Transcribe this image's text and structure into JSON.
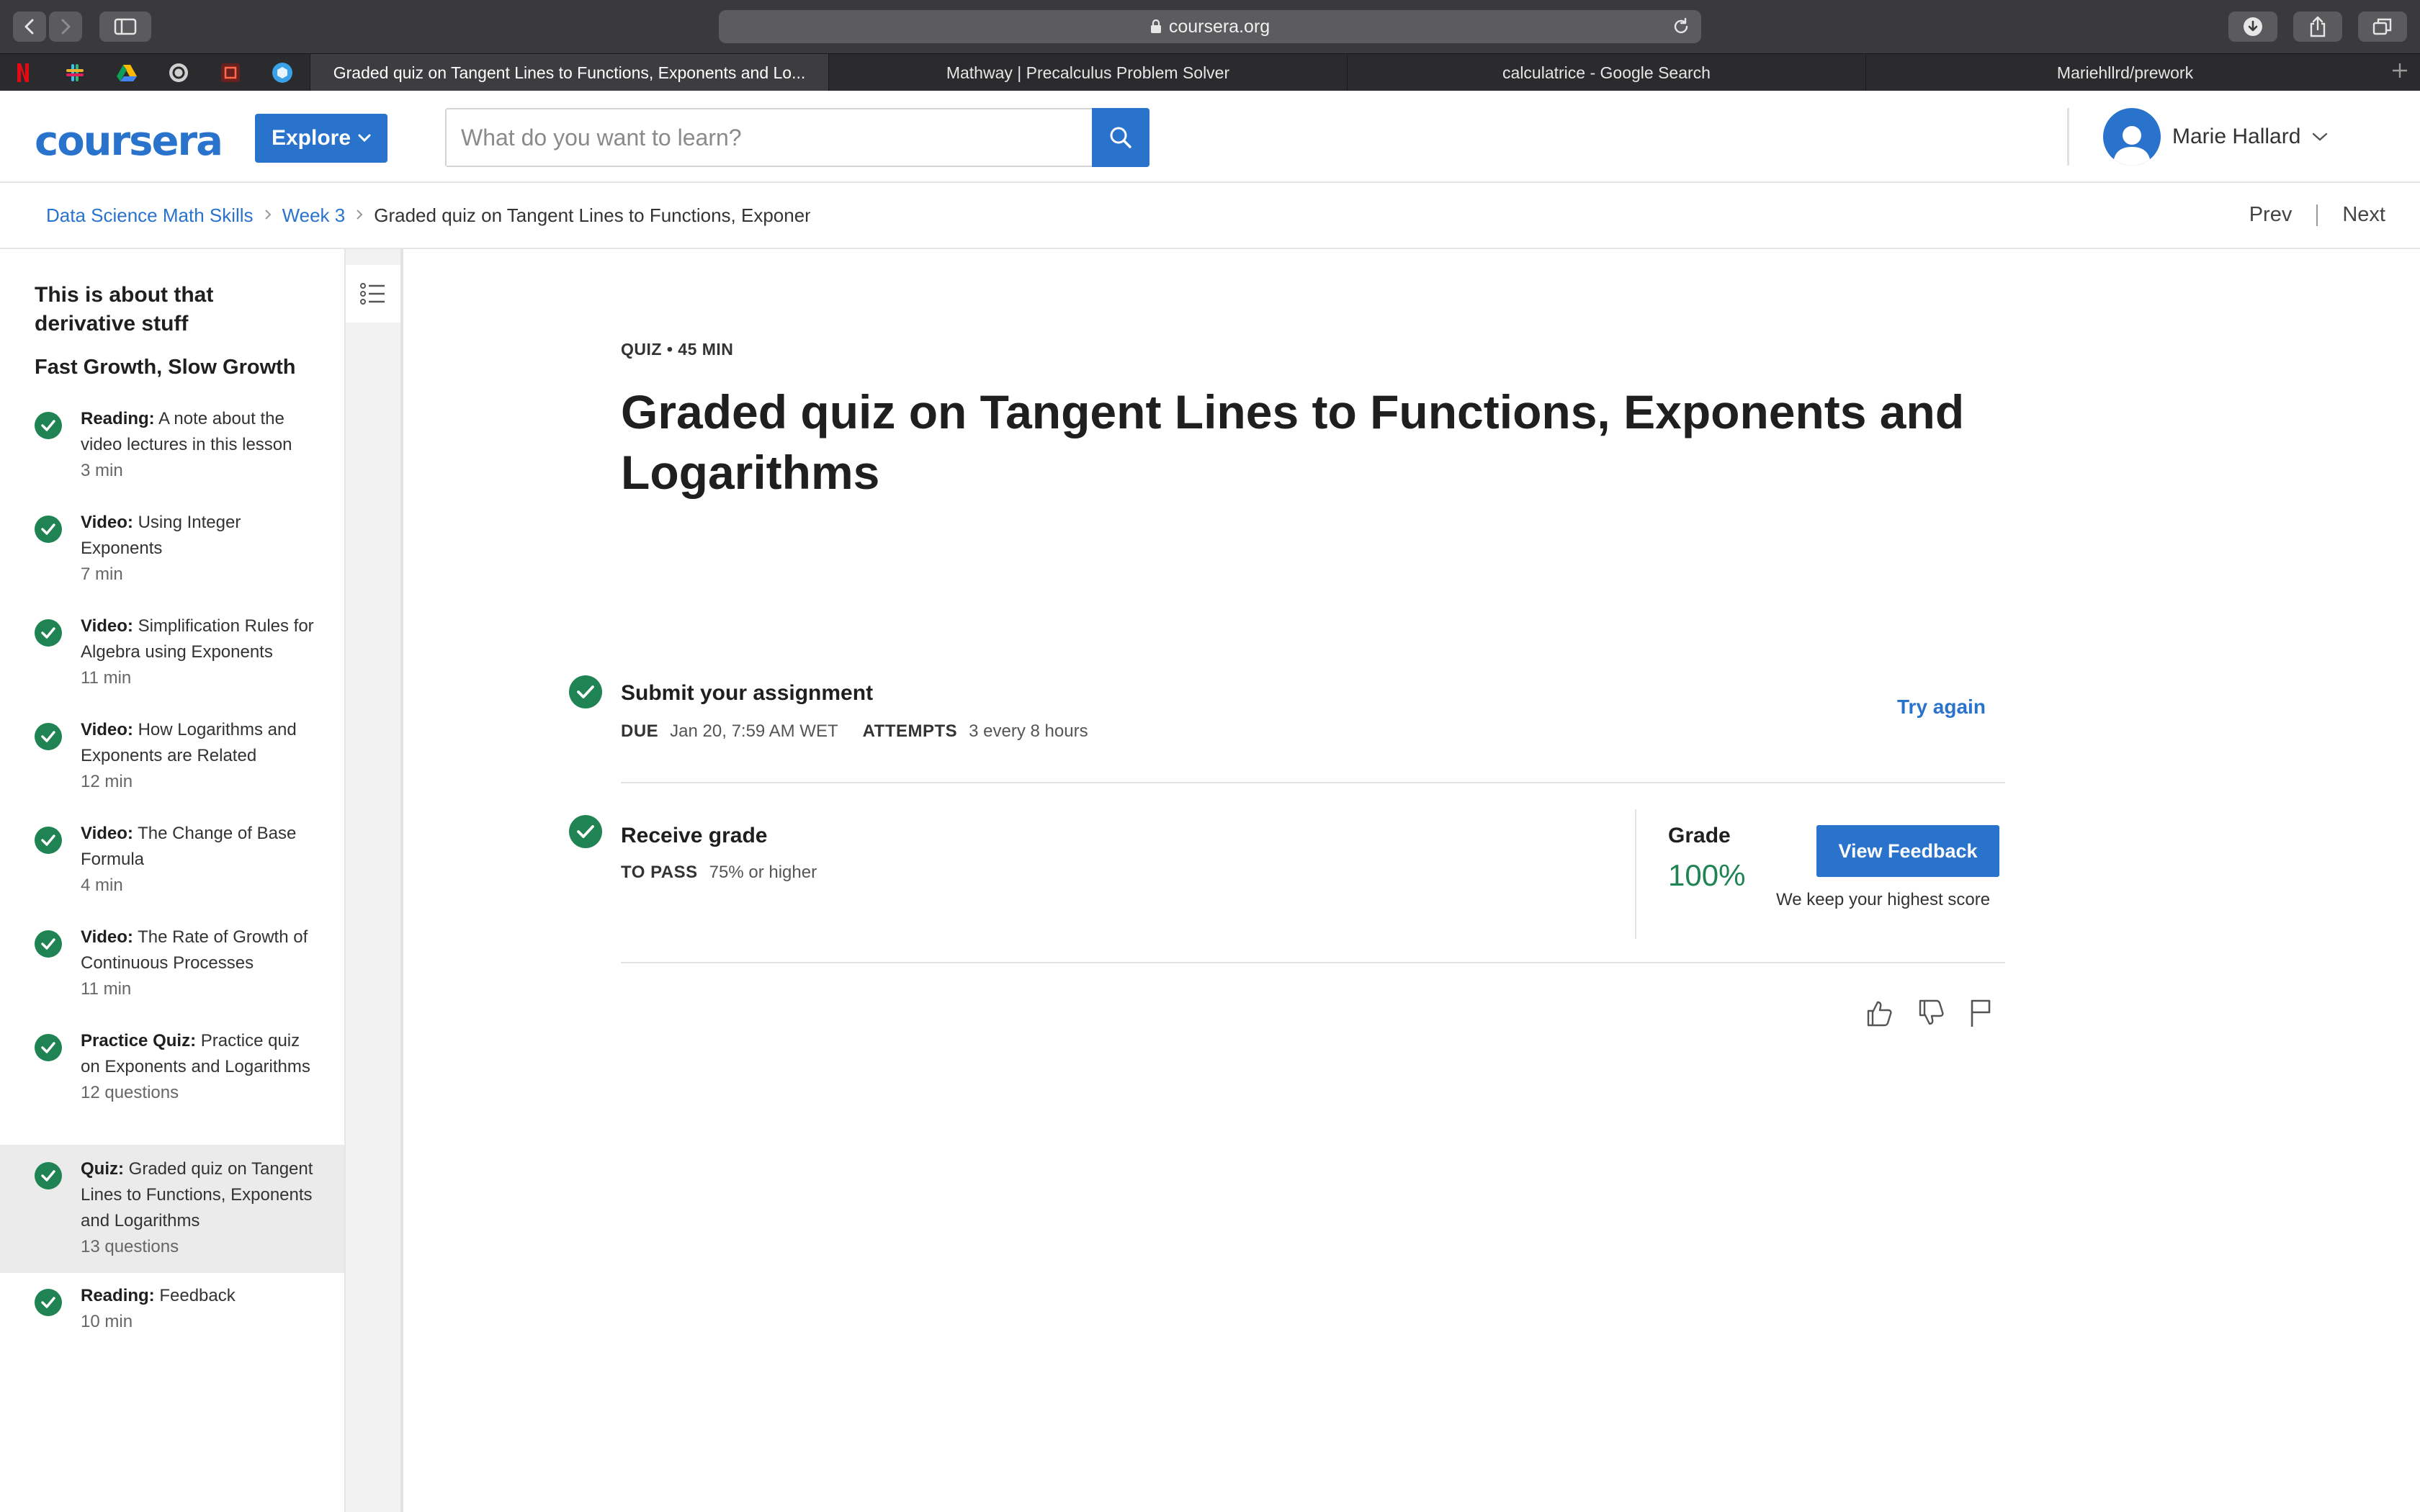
{
  "browser": {
    "url": "coursera.org",
    "tabs": [
      {
        "label": "Graded quiz on Tangent Lines to Functions, Exponents and Lo..."
      },
      {
        "label": "Mathway | Precalculus Problem Solver"
      },
      {
        "label": "calculatrice - Google Search"
      },
      {
        "label": "Mariehllrd/prework"
      }
    ]
  },
  "header": {
    "logo": "coursera",
    "explore_label": "Explore",
    "search_placeholder": "What do you want to learn?",
    "user_name": "Marie Hallard"
  },
  "breadcrumb": {
    "course": "Data Science Math Skills",
    "week": "Week 3",
    "current": "Graded quiz on Tangent Lines to Functions, Exponents and Logarithms",
    "prev": "Prev",
    "next": "Next"
  },
  "sidebar": {
    "week_title": "This is about that derivative stuff",
    "lesson_title": "Fast Growth, Slow Growth",
    "items": [
      {
        "type": "Reading:",
        "title": "A note about the video lectures in this lesson",
        "meta": "3 min"
      },
      {
        "type": "Video:",
        "title": "Using Integer Exponents",
        "meta": "7 min"
      },
      {
        "type": "Video:",
        "title": "Simplification Rules for Algebra using Exponents",
        "meta": "11 min"
      },
      {
        "type": "Video:",
        "title": "How Logarithms and Exponents are Related",
        "meta": "12 min"
      },
      {
        "type": "Video:",
        "title": "The Change of Base Formula",
        "meta": "4 min"
      },
      {
        "type": "Video:",
        "title": "The Rate of Growth of Continuous Processes",
        "meta": "11 min"
      },
      {
        "type": "Practice Quiz:",
        "title": "Practice quiz on Exponents and Logarithms",
        "meta": "12 questions"
      },
      {
        "type": "Quiz:",
        "title": "Graded quiz on Tangent Lines to Functions, Exponents and Logarithms",
        "meta": "13 questions"
      },
      {
        "type": "Reading:",
        "title": "Feedback",
        "meta": "10 min"
      }
    ]
  },
  "main": {
    "meta": "QUIZ • 45 MIN",
    "title": "Graded quiz on Tangent Lines to Functions, Exponents and Logarithms",
    "submit": {
      "title": "Submit your assignment",
      "due_label": "DUE",
      "due_value": "Jan 20, 7:59 AM WET",
      "attempts_label": "ATTEMPTS",
      "attempts_value": "3 every 8 hours",
      "try_again": "Try again"
    },
    "receive": {
      "title": "Receive grade",
      "pass_label": "TO PASS",
      "pass_value": "75% or higher",
      "grade_label": "Grade",
      "grade_value": "100%",
      "view_feedback": "View Feedback",
      "keep_note": "We keep your highest score"
    }
  },
  "colors": {
    "brand_blue": "#2a73cc",
    "success_green": "#1f8354"
  }
}
